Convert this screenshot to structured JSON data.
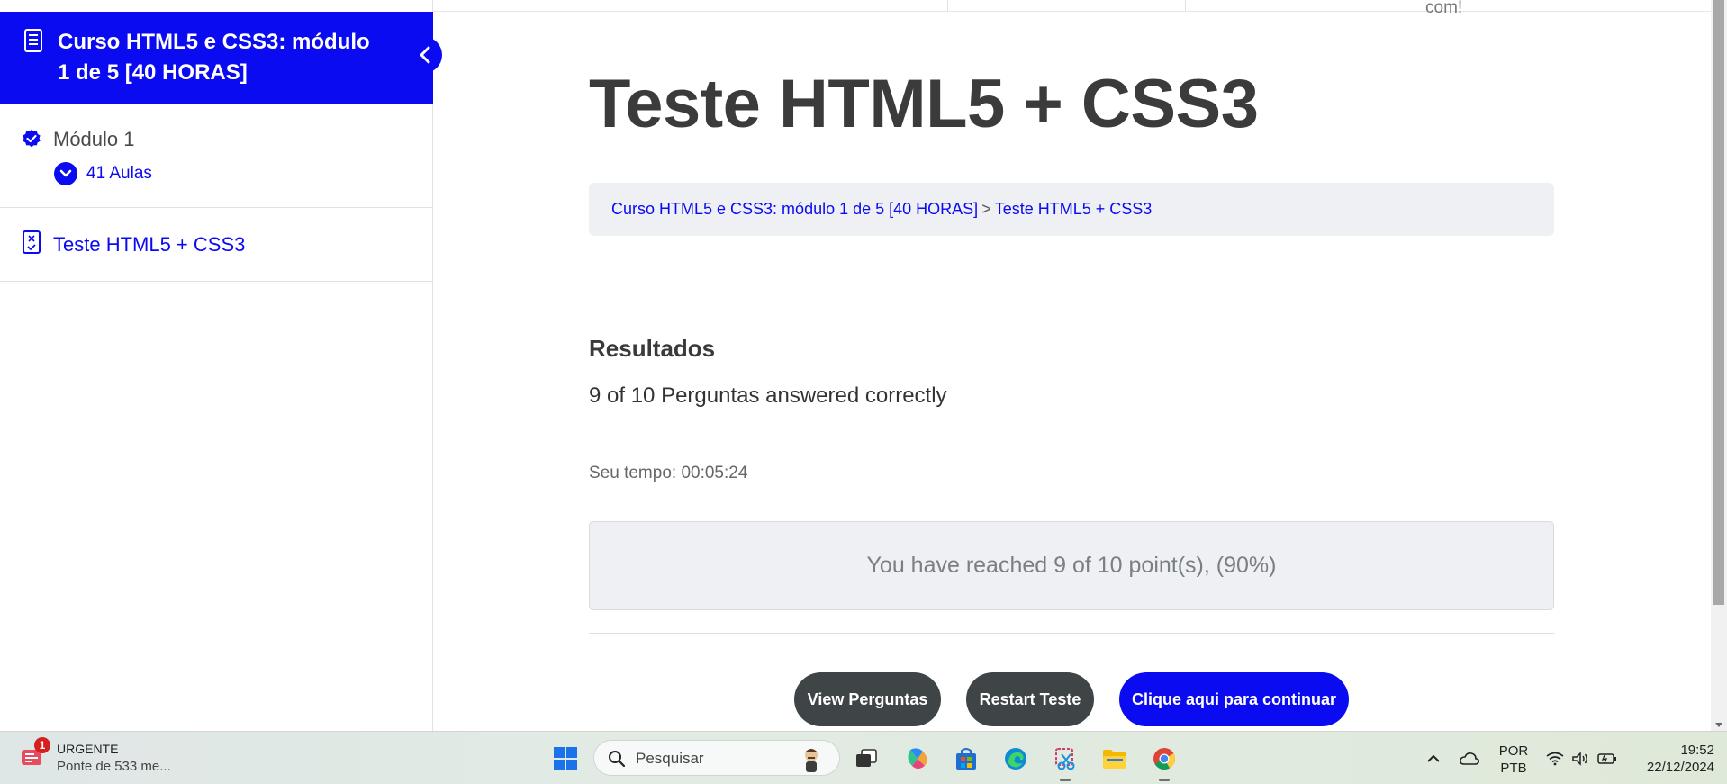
{
  "sidebar": {
    "course_title": "Curso HTML5 e CSS3: módulo 1 de 5 [40 HORAS]",
    "module_label": "Módulo 1",
    "lessons_label": "41 Aulas",
    "quiz_label": "Teste HTML5 + CSS3"
  },
  "top": {
    "partial_text": "com!"
  },
  "main": {
    "title": "Teste HTML5 + CSS3",
    "breadcrumb": {
      "course": "Curso HTML5 e CSS3: módulo 1 de 5 [40 HORAS]",
      "separator": ">",
      "current": "Teste HTML5 + CSS3"
    },
    "results_heading": "Resultados",
    "answered_text": "9 of 10 Perguntas answered correctly",
    "time_text": "Seu tempo: 00:05:24",
    "score_text": "You have reached 9 of 10 point(s), (90%)",
    "buttons": {
      "view": "View Perguntas",
      "restart": "Restart Teste",
      "continue": "Clique aqui para continuar"
    }
  },
  "taskbar": {
    "notification": {
      "badge": "1",
      "title": "URGENTE",
      "subtitle": "Ponte de 533 me..."
    },
    "search_placeholder": "Pesquisar",
    "language": {
      "line1": "POR",
      "line2": "PTB"
    },
    "clock": {
      "time": "19:52",
      "date": "22/12/2024"
    }
  },
  "colors": {
    "accent": "#0b0bf2",
    "dark_button": "#3f4447",
    "panel_bg": "#eef0f3"
  }
}
